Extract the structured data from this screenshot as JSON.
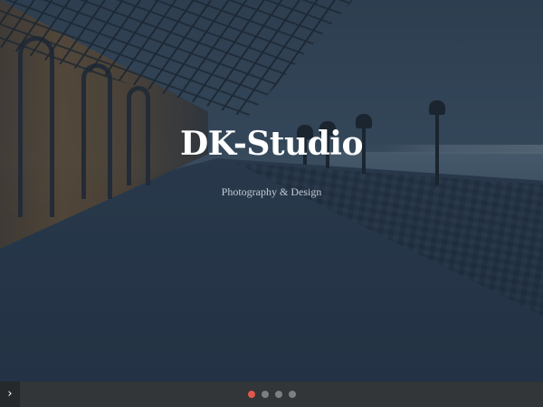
{
  "hero": {
    "title": "DK-Studio",
    "subtitle": "Photography & Design"
  },
  "slider": {
    "next_glyph": "›",
    "slides": [
      {
        "active": true
      },
      {
        "active": false
      },
      {
        "active": false
      },
      {
        "active": false
      }
    ],
    "active_dot_color": "#e2574c",
    "inactive_dot_color": "#7c8084"
  },
  "colors": {
    "overlay": "#182636",
    "bottom_bar": "#323639"
  },
  "icons": {
    "next": "chevron-right-icon"
  }
}
